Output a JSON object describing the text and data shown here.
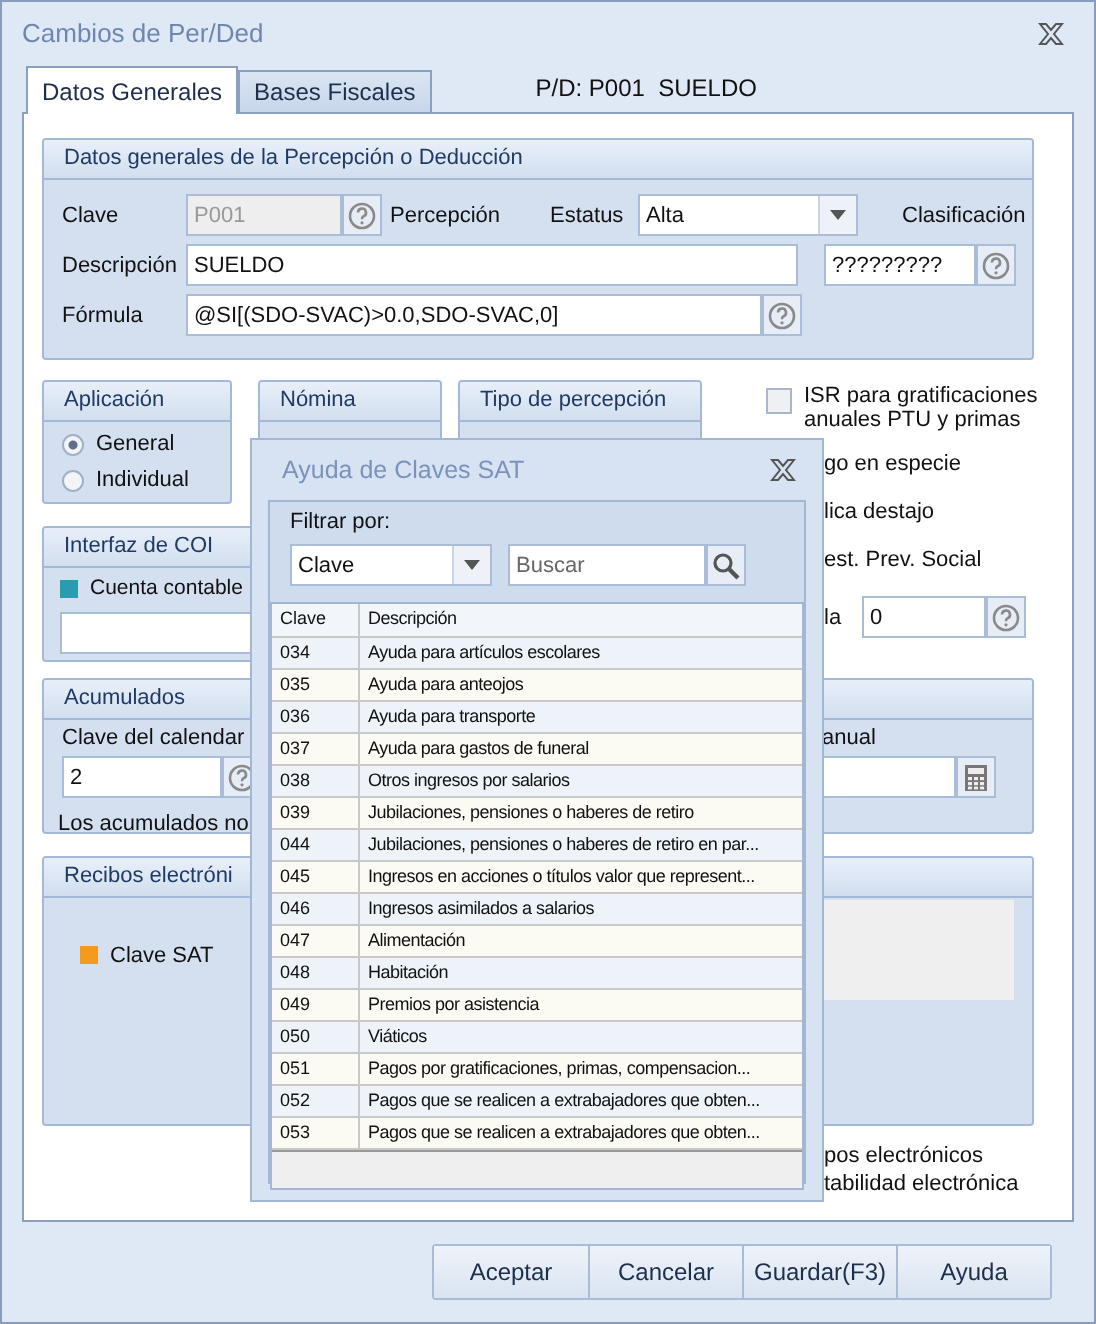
{
  "window": {
    "title": "Cambios de Per/Ded"
  },
  "tabs": [
    {
      "label": "Datos Generales",
      "selected": true
    },
    {
      "label": "Bases Fiscales",
      "selected": false
    }
  ],
  "record_label": "P/D: P001  SUELDO",
  "general": {
    "title": "Datos generales de la Percepción o Deducción",
    "clave_label": "Clave",
    "clave_value": "P001",
    "clave_disabled": true,
    "type_text": "Percepción",
    "estatus_label": "Estatus",
    "estatus_value": "Alta",
    "clasificacion_label": "Clasificación",
    "descripcion_label": "Descripción",
    "descripcion_value": "SUELDO",
    "clasificacion_value": "?????????",
    "formula_label": "Fórmula",
    "formula_value": "@SI[(SDO-SVAC)>0.0,SDO-SVAC,0]"
  },
  "aplicacion": {
    "title": "Aplicación",
    "options": [
      {
        "label": "General",
        "selected": true
      },
      {
        "label": "Individual",
        "selected": false
      }
    ]
  },
  "nomina": {
    "title": "Nómina"
  },
  "tipo_percepcion": {
    "title": "Tipo de percepción"
  },
  "isr": {
    "label": "ISR para gratificaciones anuales PTU y primas",
    "checked": false
  },
  "right_fragments": [
    "go en especie",
    "lica destajo",
    "est. Prev. Social"
  ],
  "la_label": "la",
  "la_value": "0",
  "coi": {
    "title": "Interfaz de COI",
    "cuenta_label": "Cuenta contable"
  },
  "acumulados": {
    "title": "Acumulados",
    "calendario_label": "Clave del calendar",
    "calendario_value": "2",
    "anual_label": "anual",
    "note": "Los acumulados no"
  },
  "recibos": {
    "title": "Recibos electróni",
    "clave_sat_label": "Clave SAT"
  },
  "bottom_fragments": [
    "pos electrónicos",
    "tabilidad electrónica"
  ],
  "buttons": [
    "Aceptar",
    "Cancelar",
    "Guardar(F3)",
    "Ayuda"
  ],
  "sat_popup": {
    "title": "Ayuda de Claves SAT",
    "filter_label": "Filtrar por:",
    "filter_value": "Clave",
    "search_placeholder": "Buscar",
    "columns": [
      "Clave",
      "Descripción"
    ],
    "rows": [
      [
        "034",
        "Ayuda para artículos escolares"
      ],
      [
        "035",
        "Ayuda para anteojos"
      ],
      [
        "036",
        "Ayuda para transporte"
      ],
      [
        "037",
        "Ayuda para gastos de funeral"
      ],
      [
        "038",
        "Otros ingresos por salarios"
      ],
      [
        "039",
        "Jubilaciones, pensiones o haberes de retiro"
      ],
      [
        "044",
        "Jubilaciones, pensiones o haberes de retiro en par..."
      ],
      [
        "045",
        "Ingresos en acciones o títulos valor que represent..."
      ],
      [
        "046",
        "Ingresos asimilados a salarios"
      ],
      [
        "047",
        "Alimentación"
      ],
      [
        "048",
        "Habitación"
      ],
      [
        "049",
        "Premios por asistencia"
      ],
      [
        "050",
        "Viáticos"
      ],
      [
        "051",
        "Pagos por gratificaciones, primas, compensacion..."
      ],
      [
        "052",
        "Pagos que se realicen a extrabajadores que obten..."
      ],
      [
        "053",
        "Pagos que se realicen a extrabajadores que obten..."
      ]
    ]
  }
}
